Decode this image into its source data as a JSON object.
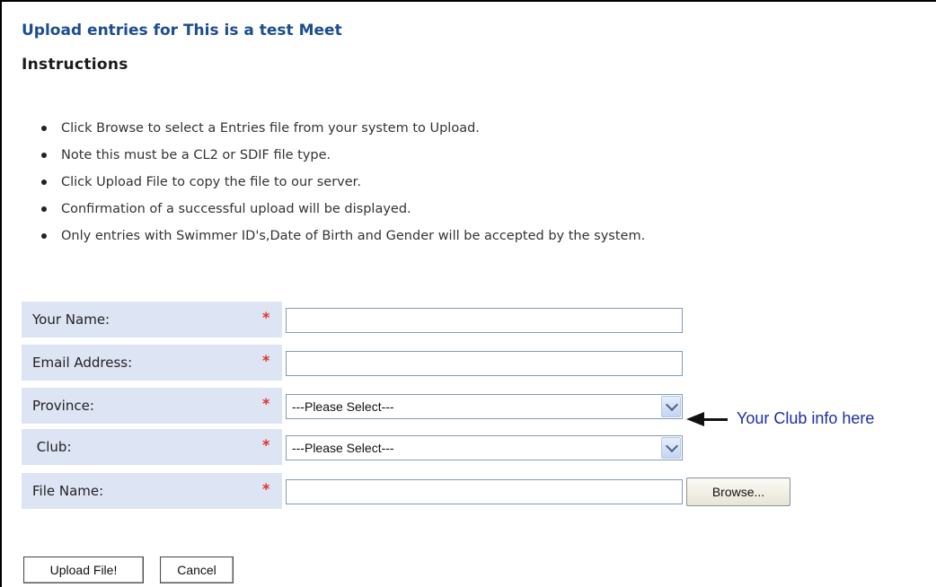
{
  "page": {
    "title": "Upload entries for This is a test Meet",
    "instructions_heading": "Instructions"
  },
  "instructions": [
    "Click Browse to select a Entries file from your system to Upload.",
    "Note this must be a CL2 or SDIF file type.",
    "Click Upload File to copy the file to our server.",
    "Confirmation of a successful upload will be displayed.",
    "Only entries with Swimmer ID's,Date of Birth and Gender will be accepted by the system."
  ],
  "form": {
    "required_marker": "*",
    "your_name": {
      "label": "Your Name:",
      "value": ""
    },
    "email": {
      "label": "Email Address:",
      "value": ""
    },
    "province": {
      "label": "Province:",
      "selected": "---Please Select---"
    },
    "club": {
      "label": " Club:",
      "selected": "---Please Select---"
    },
    "file_name": {
      "label": "File Name:",
      "value": "",
      "browse_label": "Browse..."
    }
  },
  "annotation": {
    "text": "Your Club info here"
  },
  "actions": {
    "upload_label": "Upload File!",
    "cancel_label": "Cancel"
  },
  "colors": {
    "title": "#1c4d8c",
    "label_background": "#dde4f3",
    "required": "#e0312f",
    "annotation_text": "#1f2fa3"
  },
  "icons": {
    "dropdown": "chevron-down-icon",
    "annotation_arrow": "arrow-left-icon",
    "bullet": "bullet-icon"
  }
}
